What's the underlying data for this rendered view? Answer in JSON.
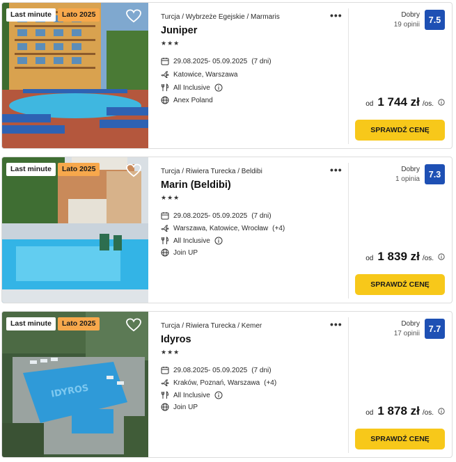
{
  "offers": [
    {
      "badges": {
        "last_minute": "Last minute",
        "season": "Lato 2025"
      },
      "location": "Turcja / Wybrzeże Egejskie / Marmaris",
      "name": "Juniper",
      "stars": 3,
      "dates": "29.08.2025- 05.09.2025",
      "duration": "(7 dni)",
      "departure": "Katowice, Warszawa",
      "departure_extra": "",
      "board": "All Inclusive",
      "operator": "Anex Poland",
      "rating_label": "Dobry",
      "reviews": "19 opinii",
      "score": "7.5",
      "price_from": "od",
      "price": "1 744 zł",
      "per_person": "/os.",
      "cta": "SPRAWDŹ CENĘ"
    },
    {
      "badges": {
        "last_minute": "Last minute",
        "season": "Lato 2025"
      },
      "location": "Turcja / Riwiera Turecka / Beldibi",
      "name": "Marin (Beldibi)",
      "stars": 3,
      "dates": "29.08.2025- 05.09.2025",
      "duration": "(7 dni)",
      "departure": "Warszawa, Katowice, Wrocław",
      "departure_extra": "(+4)",
      "board": "All Inclusive",
      "operator": "Join UP",
      "rating_label": "Dobry",
      "reviews": "1 opinia",
      "score": "7.3",
      "price_from": "od",
      "price": "1 839 zł",
      "per_person": "/os.",
      "cta": "SPRAWDŹ CENĘ"
    },
    {
      "badges": {
        "last_minute": "Last minute",
        "season": "Lato 2025"
      },
      "location": "Turcja / Riwiera Turecka / Kemer",
      "name": "Idyros",
      "stars": 3,
      "dates": "29.08.2025- 05.09.2025",
      "duration": "(7 dni)",
      "departure": "Kraków, Poznań, Warszawa",
      "departure_extra": "(+4)",
      "board": "All Inclusive",
      "operator": "Join UP",
      "rating_label": "Dobry",
      "reviews": "17 opinii",
      "score": "7.7",
      "price_from": "od",
      "price": "1 878 zł",
      "per_person": "/os.",
      "cta": "SPRAWDŹ CENĘ"
    }
  ],
  "pool_sign": "IDYROS",
  "icons": {
    "stars": "star-icon",
    "dates": "calendar-icon",
    "departure": "plane-icon",
    "board": "cutlery-icon",
    "board_info": "info-icon",
    "operator": "globe-icon",
    "price_info": "info-icon",
    "favorite": "heart-icon",
    "more": "more-dots-icon"
  },
  "colors": {
    "score_bg": "#1e50b4",
    "cta_bg": "#f7c81a",
    "season_badge": "#f7a84c"
  }
}
